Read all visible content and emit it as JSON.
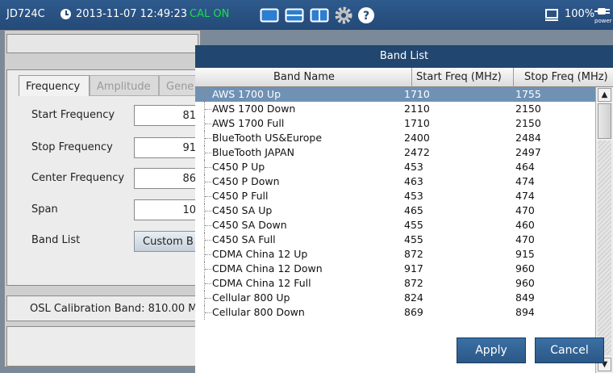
{
  "statusbar": {
    "device": "JD724C",
    "datetime": "2013-11-07 12:49:23",
    "cal_status": "CAL ON",
    "battery": "100%",
    "power_label": "power",
    "icons": [
      "clock-icon",
      "single-view-icon",
      "dual-view-icon",
      "split-view-icon",
      "settings-gear-icon",
      "help-icon",
      "screen-icon",
      "power-plug-icon"
    ],
    "colors": {
      "cal_on": "#16e04a",
      "bar": "#244a78"
    }
  },
  "left_panel": {
    "tabs": [
      "Frequency",
      "Amplitude",
      "Gene"
    ],
    "fields": [
      {
        "label": "Start Frequency",
        "value": "81"
      },
      {
        "label": "Stop Frequency",
        "value": "91"
      },
      {
        "label": "Center Frequency",
        "value": "86"
      },
      {
        "label": "Span",
        "value": "10"
      }
    ],
    "band_list_label": "Band List",
    "band_list_button": "Custom B",
    "osl_label": "OSL Calibration Band: 810.00 M"
  },
  "band_dialog": {
    "title": "Band List",
    "columns": [
      "Band Name",
      "Start Freq (MHz)",
      "Stop Freq (MHz)"
    ],
    "selected_index": 0,
    "rows": [
      [
        "AWS 1700 Up",
        "1710",
        "1755"
      ],
      [
        "AWS 1700 Down",
        "2110",
        "2150"
      ],
      [
        "AWS 1700 Full",
        "1710",
        "2150"
      ],
      [
        "BlueTooth US&Europe",
        "2400",
        "2484"
      ],
      [
        "BlueTooth JAPAN",
        "2472",
        "2497"
      ],
      [
        "C450 P Up",
        "453",
        "464"
      ],
      [
        "C450 P Down",
        "463",
        "474"
      ],
      [
        "C450 P Full",
        "453",
        "474"
      ],
      [
        "C450 SA Up",
        "465",
        "470"
      ],
      [
        "C450 SA Down",
        "455",
        "460"
      ],
      [
        "C450 SA Full",
        "455",
        "470"
      ],
      [
        "CDMA China 12 Up",
        "872",
        "915"
      ],
      [
        "CDMA China 12 Down",
        "917",
        "960"
      ],
      [
        "CDMA China 12 Full",
        "872",
        "960"
      ],
      [
        "Cellular 800 Up",
        "824",
        "849"
      ],
      [
        "Cellular 800 Down",
        "869",
        "894"
      ]
    ],
    "apply_label": "Apply",
    "cancel_label": "Cancel"
  }
}
